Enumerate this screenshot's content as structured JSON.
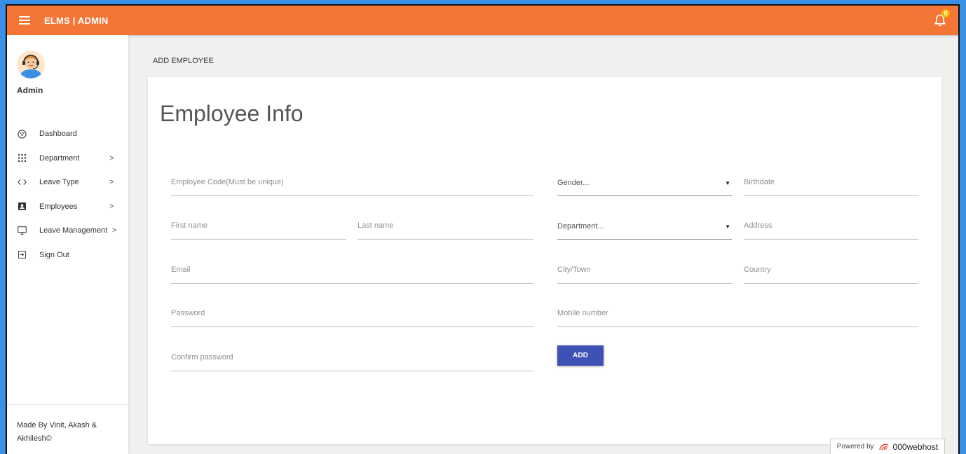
{
  "header": {
    "brand": "ELMS | ADMIN",
    "notification_count": "0"
  },
  "sidebar": {
    "user_name": "Admin",
    "items": [
      {
        "label": "Dashboard",
        "icon": "dashboard-icon",
        "has_submenu": false
      },
      {
        "label": "Department",
        "icon": "apps-grid-icon",
        "has_submenu": true
      },
      {
        "label": "Leave Type",
        "icon": "code-icon",
        "has_submenu": true
      },
      {
        "label": "Employees",
        "icon": "account-box-icon",
        "has_submenu": true
      },
      {
        "label": "Leave Management",
        "icon": "desktop-icon",
        "has_submenu": true
      },
      {
        "label": "Sign Out",
        "icon": "exit-icon",
        "has_submenu": false
      }
    ],
    "footer": "Made By Vinit, Akash & Akhilesh©"
  },
  "page": {
    "title": "ADD EMPLOYEE"
  },
  "form": {
    "title": "Employee Info",
    "employee_code": {
      "value": "",
      "placeholder": "Employee Code(Must be unique)"
    },
    "first_name": {
      "value": "",
      "placeholder": "First name"
    },
    "last_name": {
      "value": "",
      "placeholder": "Last name"
    },
    "email": {
      "value": "",
      "placeholder": "Email"
    },
    "password": {
      "value": "",
      "placeholder": "Password"
    },
    "confirm_password": {
      "value": "",
      "placeholder": "Confirm password"
    },
    "gender": {
      "selected": "Gender..."
    },
    "department": {
      "selected": "Department..."
    },
    "birthdate": {
      "value": "",
      "placeholder": "Birthdate"
    },
    "address": {
      "value": "",
      "placeholder": "Address"
    },
    "city": {
      "value": "",
      "placeholder": "City/Town"
    },
    "country": {
      "value": "",
      "placeholder": "Country"
    },
    "mobile": {
      "value": "",
      "placeholder": "Mobile number"
    },
    "add_label": "ADD"
  },
  "powered_by": {
    "label": "Powered by",
    "brand": "000webhost"
  },
  "colors": {
    "header": "#f47637",
    "button": "#3f51b5",
    "badge": "#f5b800"
  }
}
